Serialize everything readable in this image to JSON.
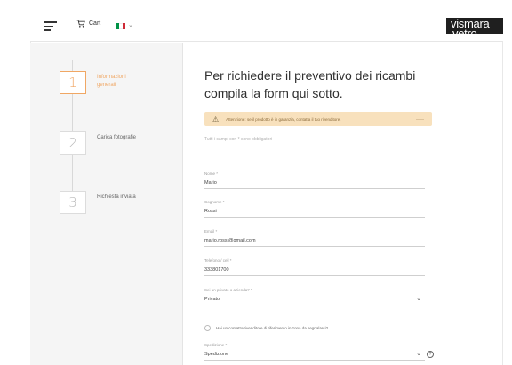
{
  "header": {
    "cart_label": "Cart",
    "logo_line1": "vismara",
    "logo_line2": "vetro",
    "flag_colors": [
      "#009246",
      "#ffffff",
      "#ce2b37"
    ],
    "icons": [
      "menu-icon",
      "cart-icon",
      "chevron-down-icon"
    ]
  },
  "steps": [
    {
      "number": "1",
      "label": "Informazioni generali",
      "active": true
    },
    {
      "number": "2",
      "label": "Carica fotografie",
      "active": false
    },
    {
      "number": "3",
      "label": "Richiesta inviata",
      "active": false
    }
  ],
  "form": {
    "title": "Per richiedere il preventivo dei ricambi compila la form qui sotto.",
    "alert_text": "Attenzione: se il prodotto è in garanzia, contatta il tuo rivenditore.",
    "alert_icon": "warning-icon",
    "required_note": "Tutti i campi con * sono obbligatori",
    "fields": {
      "nome": {
        "label": "Nome *",
        "value": "Mario"
      },
      "cognome": {
        "label": "Cognome *",
        "value": "Rossi"
      },
      "email": {
        "label": "Email *",
        "value": "mario.rossi@gmail.com"
      },
      "telefono": {
        "label": "Telefono / cell *",
        "value": "333801700"
      },
      "tipo": {
        "label": "Sei un privato o azienda? *",
        "value": "Privato"
      },
      "spedizione": {
        "label": "Spedizione *",
        "value": "Spedizione"
      }
    },
    "checkbox_label": "Hai un contatto/rivenditore di riferimento in zona da segnalarci?"
  },
  "colors": {
    "accent": "#f0a764",
    "alert_bg": "#f8e1bd",
    "sidebar_bg": "#f5f5f5"
  }
}
